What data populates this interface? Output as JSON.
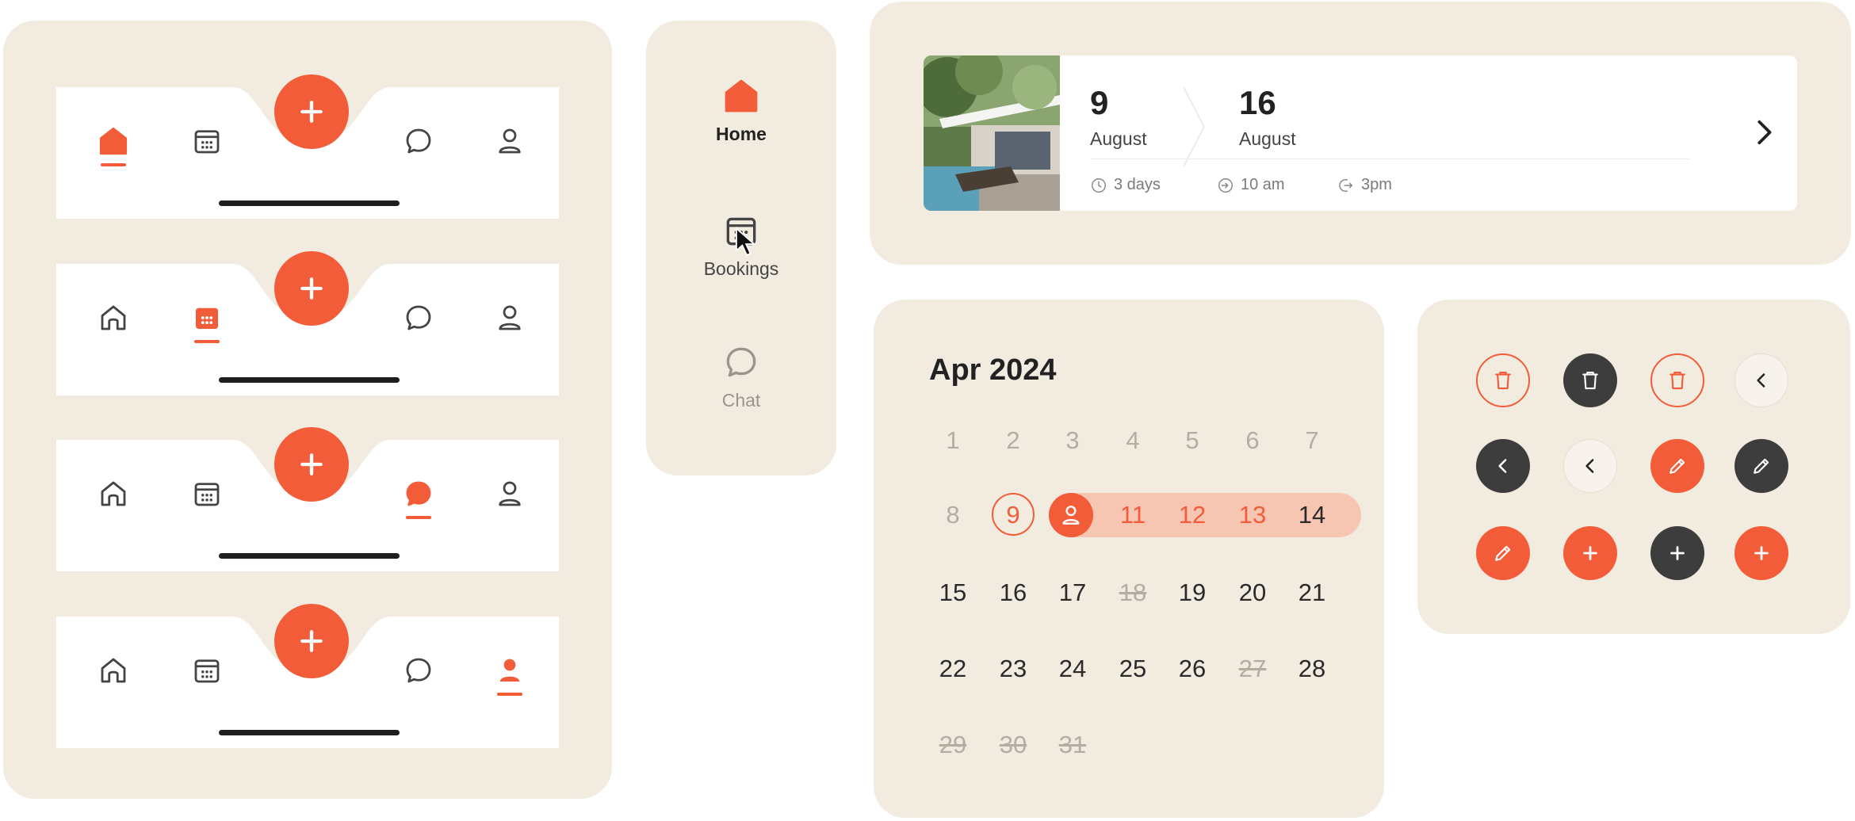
{
  "colors": {
    "accent": "#f25c38",
    "panel": "#f2ebe0",
    "dark": "#3d3d3d",
    "range": "#f7c6b3"
  },
  "nav_bars": [
    {
      "active": "home"
    },
    {
      "active": "bookings"
    },
    {
      "active": "chat"
    },
    {
      "active": "profile"
    }
  ],
  "nav_icons": [
    "home-icon",
    "calendar-icon",
    "add-icon",
    "chat-icon",
    "profile-icon"
  ],
  "side_rail": {
    "items": [
      {
        "label": "Home",
        "icon": "home-icon",
        "state": "active"
      },
      {
        "label": "Bookings",
        "icon": "calendar-icon",
        "state": "hover"
      },
      {
        "label": "Chat",
        "icon": "chat-icon",
        "state": "inactive"
      }
    ]
  },
  "booking": {
    "checkin_day": "9",
    "checkin_month": "August",
    "checkout_day": "16",
    "checkout_month": "August",
    "duration": "3 days",
    "checkin_time": "10 am",
    "checkout_time": "3pm"
  },
  "calendar": {
    "title": "Apr 2024",
    "header_days": [
      "1",
      "2",
      "3",
      "4",
      "5",
      "6",
      "7"
    ],
    "rows": [
      [
        "8",
        "9",
        "",
        "11",
        "12",
        "13",
        "14"
      ],
      [
        "15",
        "16",
        "17",
        "18",
        "19",
        "20",
        "21"
      ],
      [
        "22",
        "23",
        "24",
        "25",
        "26",
        "27",
        "28"
      ],
      [
        "29",
        "30",
        "31"
      ]
    ],
    "selected_start": "9",
    "range_start_icon": "profile-icon",
    "range_days": [
      "11",
      "12",
      "13"
    ],
    "unavailable_days": [
      "18",
      "27",
      "29",
      "30",
      "31"
    ]
  },
  "icon_buttons": [
    {
      "icon": "trash-icon",
      "style": "outline-orange"
    },
    {
      "icon": "trash-icon",
      "style": "dark"
    },
    {
      "icon": "trash-icon",
      "style": "outline-orange"
    },
    {
      "icon": "chevron-left-icon",
      "style": "light"
    },
    {
      "icon": "chevron-left-icon",
      "style": "dark"
    },
    {
      "icon": "chevron-left-icon",
      "style": "light"
    },
    {
      "icon": "pencil-icon",
      "style": "orange"
    },
    {
      "icon": "pencil-icon",
      "style": "dark"
    },
    {
      "icon": "pencil-icon",
      "style": "orange"
    },
    {
      "icon": "plus-icon",
      "style": "orange"
    },
    {
      "icon": "plus-icon",
      "style": "dark"
    },
    {
      "icon": "plus-icon",
      "style": "orange"
    }
  ]
}
